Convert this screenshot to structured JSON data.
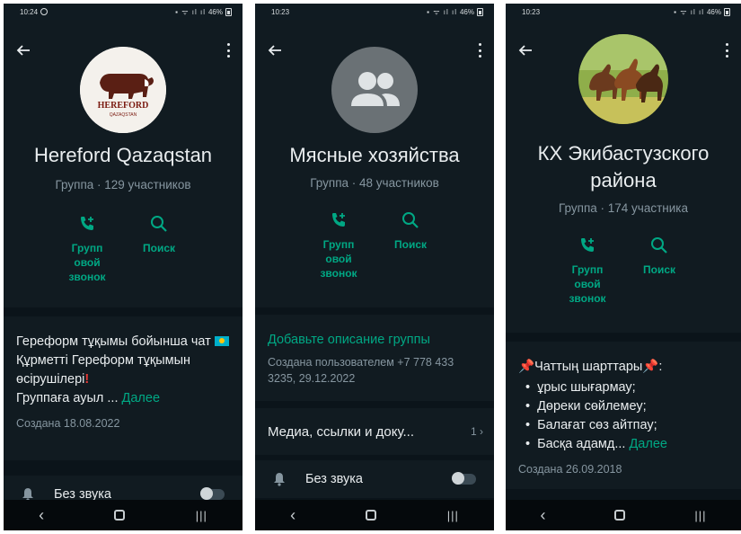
{
  "screens": [
    {
      "status_time": "10:24",
      "battery": "46%",
      "title": "Hereford Qazaqstan",
      "subtitle": "Группа · 129 участников",
      "avatar_logo_text": "HEREFORD",
      "avatar_logo_sub": "QAZAQSTAN",
      "call_label": "Групп\nовой\nзвонок",
      "search_label": "Поиск",
      "description": "Гереформ тұқымы бойынша чат",
      "description_line2": "Құрметті Гереформ тұқымын өсірушілері",
      "description_line3": "Группаға ауыл ...",
      "more_label": "Далее",
      "created": "Создана 18.08.2022",
      "mute_label": "Без звука"
    },
    {
      "status_time": "10:23",
      "battery": "46%",
      "title": "Мясные хозяйства",
      "subtitle": "Группа · 48 участников",
      "call_label": "Групп\nовой\nзвонок",
      "search_label": "Поиск",
      "add_description": "Добавьте описание группы",
      "created": "Создана пользователем +7 778 433 3235, 29.12.2022",
      "media_label": "Медиа, ссылки и доку...",
      "media_count": "1 ›",
      "mute_label": "Без звука"
    },
    {
      "status_time": "10:23",
      "battery": "46%",
      "title": "КХ Экибастузского района",
      "subtitle": "Группа · 174 участника",
      "call_label": "Групп\nовой\nзвонок",
      "search_label": "Поиск",
      "rules_title": "Чаттың шарттары",
      "rules": [
        "ұрыс шығармау;",
        "Дөреки сөйлемеу;",
        "Балағат сөз айтпау;",
        "Басқа адамд..."
      ],
      "more_label": "Далее",
      "created": "Создана 26.09.2018"
    }
  ]
}
